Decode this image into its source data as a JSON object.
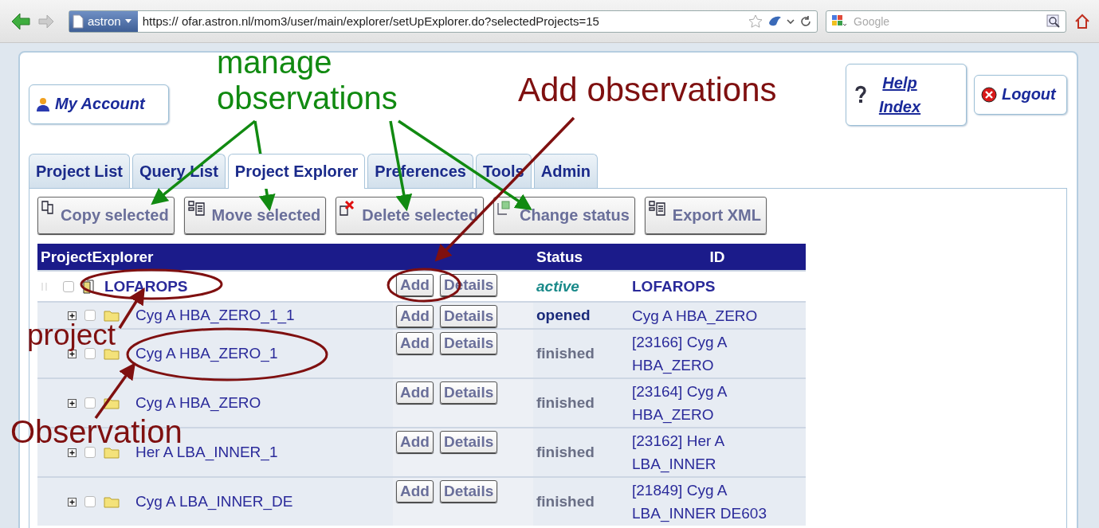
{
  "browser": {
    "site_badge": "astron",
    "url": "https:// ofar.astron.nl/mom3/user/main/explorer/setUpExplorer.do?selectedProjects=15",
    "search_placeholder": "Google"
  },
  "header": {
    "my_account": "My Account",
    "help": "Help Index",
    "logout": "Logout"
  },
  "tabs": [
    {
      "label": "Project List",
      "selected": false
    },
    {
      "label": "Query List",
      "selected": false
    },
    {
      "label": "Project Explorer",
      "selected": true
    },
    {
      "label": "Preferences",
      "selected": false
    },
    {
      "label": "Tools",
      "selected": false
    },
    {
      "label": "Admin",
      "selected": false
    }
  ],
  "actions": [
    {
      "label": "Copy selected",
      "kind": "copy"
    },
    {
      "label": "Move selected",
      "kind": "move"
    },
    {
      "label": "Delete selected",
      "kind": "delete"
    },
    {
      "label": "Change status",
      "kind": "status"
    },
    {
      "label": "Export XML",
      "kind": "export"
    }
  ],
  "table": {
    "columns": [
      "ProjectExplorer",
      "Status",
      "ID"
    ],
    "rows": [
      {
        "kind": "project",
        "name": "LOFAROPS",
        "checked": false,
        "add": "Add",
        "details": "Details",
        "status": "active",
        "color": "#1a8a8a",
        "id": "LOFAROPS"
      },
      {
        "kind": "observation",
        "name": "Cyg A HBA_ZERO_1_1",
        "checked": false,
        "add": "Add",
        "details": "Details",
        "status": "opened",
        "color": "#1a2a7a",
        "id": "Cyg A HBA_ZERO"
      },
      {
        "kind": "observation",
        "name": "Cyg A HBA_ZERO_1",
        "checked": false,
        "add": "Add",
        "details": "Details",
        "status": "finished",
        "color": "#6a6f86",
        "id": "[23166] Cyg A HBA_ZERO"
      },
      {
        "kind": "observation",
        "name": "Cyg A HBA_ZERO",
        "checked": false,
        "add": "Add",
        "details": "Details",
        "status": "finished",
        "color": "#6a6f86",
        "id": "[23164] Cyg A HBA_ZERO"
      },
      {
        "kind": "observation",
        "name": "Her A LBA_INNER_1",
        "checked": false,
        "add": "Add",
        "details": "Details",
        "status": "finished",
        "color": "#6a6f86",
        "id": "[23162] Her A LBA_INNER"
      },
      {
        "kind": "observation",
        "name": "Cyg A LBA_INNER_DE",
        "checked": false,
        "add": "Add",
        "details": "Details",
        "status": "finished",
        "color": "#6a6f86",
        "id": "[21849] Cyg A LBA_INNER DE603"
      }
    ]
  },
  "annotations": [
    {
      "text": "manage observations",
      "color": "#118a11"
    },
    {
      "text": "Add observations",
      "color": "#7f1010"
    },
    {
      "text": "project",
      "color": "#7f1010"
    },
    {
      "text": "Observation",
      "color": "#7f1010"
    }
  ]
}
